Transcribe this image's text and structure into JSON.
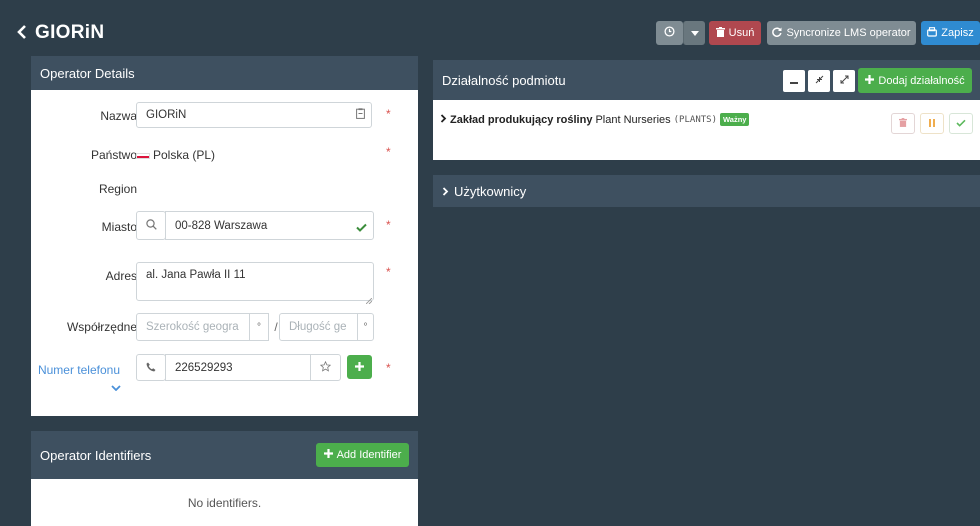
{
  "header": {
    "title": "GIORiN",
    "delete_label": "Usuń",
    "sync_label": "Syncronize LMS operator",
    "save_label": "Zapisz"
  },
  "details": {
    "title": "Operator Details",
    "name_label": "Nazwa",
    "name_value": "GIORiN",
    "country_label": "Państwo",
    "country_value": "Polska (PL)",
    "region_label": "Region",
    "city_label": "Miasto",
    "city_value": "00-828 Warszawa",
    "address_label": "Adres",
    "address_value": "al. Jana Pawła II 11",
    "coords_label": "Współrzędne",
    "lat_placeholder": "Szerokość geogra",
    "lon_placeholder": "Długość ge",
    "degree": "°",
    "slash": "/",
    "phone_label": "Numer telefonu",
    "phone_value": "226529293",
    "required_mark": "*"
  },
  "identifiers": {
    "title": "Operator Identifiers",
    "add_label": "Add Identifier",
    "empty_text": "No identifiers."
  },
  "activities": {
    "title": "Działalność podmiotu",
    "add_label": "Dodaj działalność",
    "row": {
      "type": "Zakład produkujący rośliny",
      "name": "Plant Nurseries",
      "code": "(PLANTS)",
      "status": "Ważny"
    }
  },
  "users": {
    "title": "Użytkownicy"
  },
  "colors": {
    "background": "#2e3e4a",
    "panel_header": "#3e5060",
    "success": "#4cae4c",
    "danger": "#b0484f",
    "primary": "#2f8bd1",
    "link": "#4a90d9"
  }
}
